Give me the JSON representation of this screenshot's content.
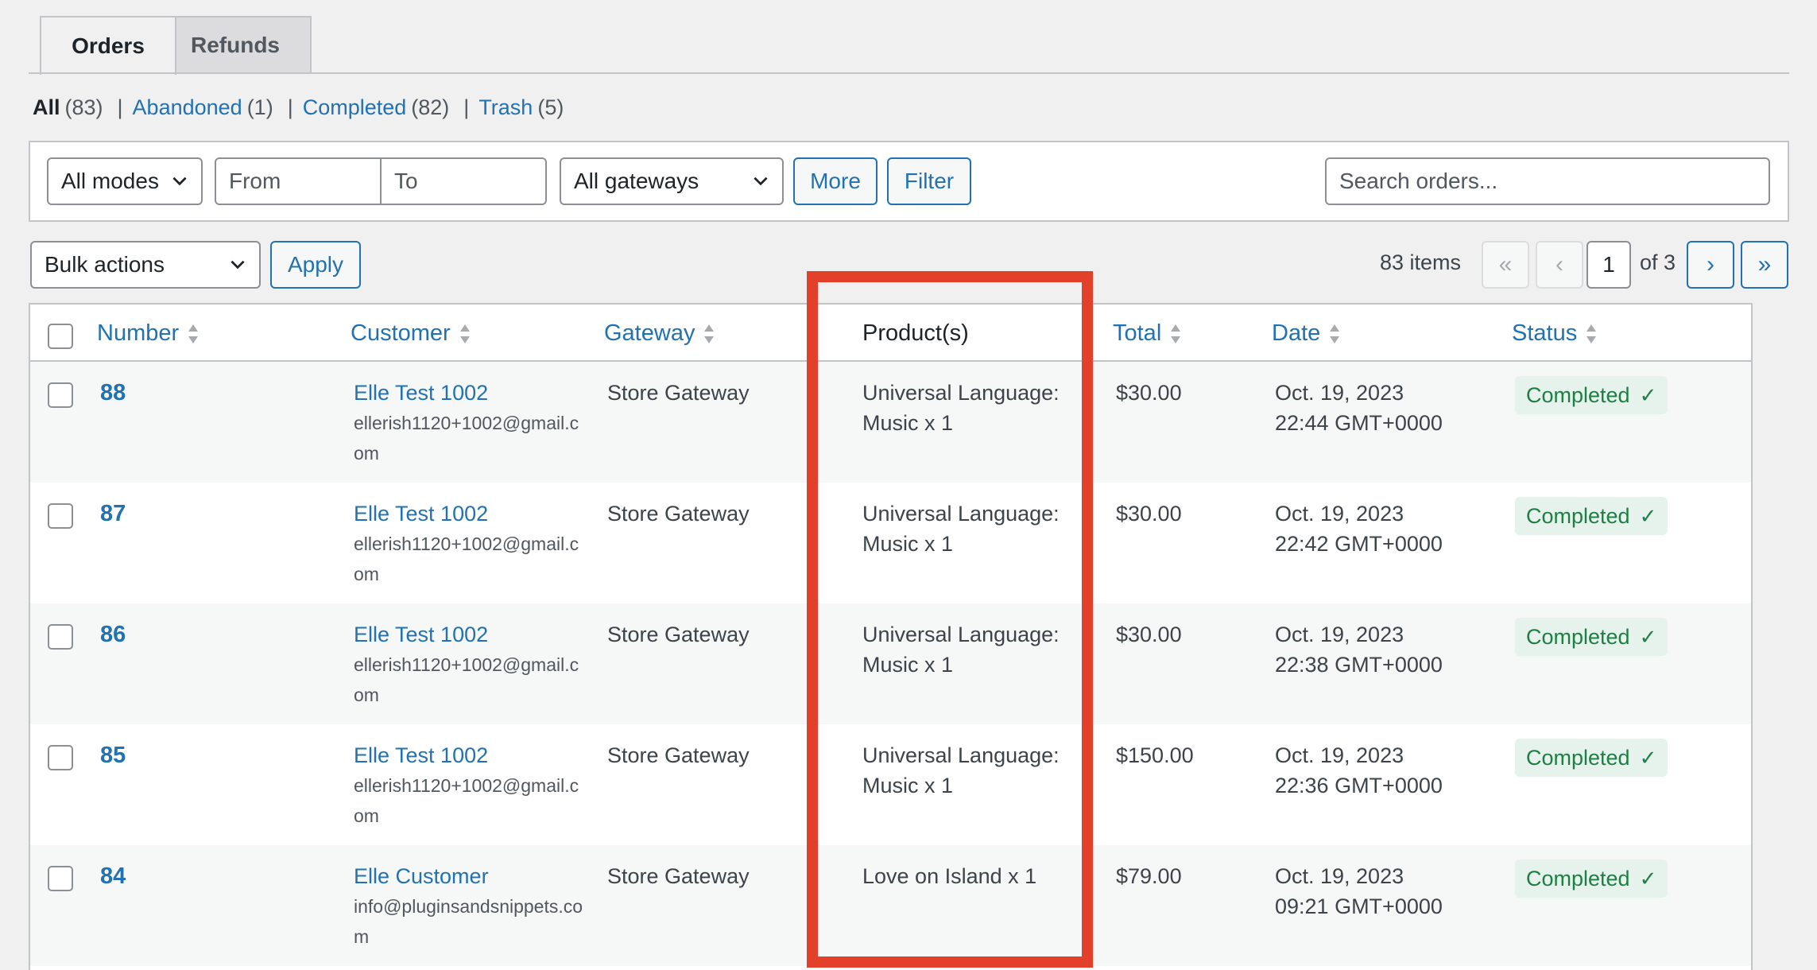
{
  "tabs": [
    {
      "label": "Orders",
      "active": true
    },
    {
      "label": "Refunds",
      "active": false
    }
  ],
  "views": {
    "all_label": "All",
    "all_count": "(83)",
    "abandoned_label": "Abandoned",
    "abandoned_count": "(1)",
    "completed_label": "Completed",
    "completed_count": "(82)",
    "trash_label": "Trash",
    "trash_count": "(5)",
    "separator": "|"
  },
  "filters": {
    "mode_select": "All modes",
    "from_placeholder": "From",
    "to_placeholder": "To",
    "gateway_select": "All gateways",
    "more_label": "More",
    "filter_label": "Filter",
    "search_placeholder": "Search orders..."
  },
  "tablenav": {
    "bulk_select": "Bulk actions",
    "apply_label": "Apply",
    "items_count": "83 items",
    "first_page": "«",
    "prev_page": "‹",
    "current_page": "1",
    "of_pages": "of 3",
    "next_page": "›",
    "last_page": "»"
  },
  "table": {
    "columns": {
      "number": "Number",
      "customer": "Customer",
      "gateway": "Gateway",
      "products": "Product(s)",
      "total": "Total",
      "date": "Date",
      "status": "Status"
    },
    "rows": [
      {
        "number": "88",
        "customer_name": "Elle Test 1002",
        "customer_email": "ellerish1120+1002@gmail.com",
        "gateway": "Store Gateway",
        "product_line1": "Universal Language:",
        "product_line2": "Music x 1",
        "total": "$30.00",
        "date_line1": "Oct. 19, 2023",
        "date_line2": "22:44 GMT+0000",
        "status": "Completed"
      },
      {
        "number": "87",
        "customer_name": "Elle Test 1002",
        "customer_email": "ellerish1120+1002@gmail.com",
        "gateway": "Store Gateway",
        "product_line1": "Universal Language:",
        "product_line2": "Music x 1",
        "total": "$30.00",
        "date_line1": "Oct. 19, 2023",
        "date_line2": "22:42 GMT+0000",
        "status": "Completed"
      },
      {
        "number": "86",
        "customer_name": "Elle Test 1002",
        "customer_email": "ellerish1120+1002@gmail.com",
        "gateway": "Store Gateway",
        "product_line1": "Universal Language:",
        "product_line2": "Music x 1",
        "total": "$30.00",
        "date_line1": "Oct. 19, 2023",
        "date_line2": "22:38 GMT+0000",
        "status": "Completed"
      },
      {
        "number": "85",
        "customer_name": "Elle Test 1002",
        "customer_email": "ellerish1120+1002@gmail.com",
        "gateway": "Store Gateway",
        "product_line1": "Universal Language:",
        "product_line2": "Music x 1",
        "total": "$150.00",
        "date_line1": "Oct. 19, 2023",
        "date_line2": "22:36 GMT+0000",
        "status": "Completed"
      },
      {
        "number": "84",
        "customer_name": "Elle Customer",
        "customer_email": "info@pluginsandsnippets.com",
        "gateway": "Store Gateway",
        "product_line1": "Love on Island x 1",
        "product_line2": "",
        "total": "$79.00",
        "date_line1": "Oct. 19, 2023",
        "date_line2": "09:21 GMT+0000",
        "status": "Completed"
      }
    ]
  },
  "colors": {
    "link": "#2271b1",
    "status_bg": "#e6f3ec",
    "status_text": "#1e7e44",
    "highlight": "#e3402b"
  }
}
